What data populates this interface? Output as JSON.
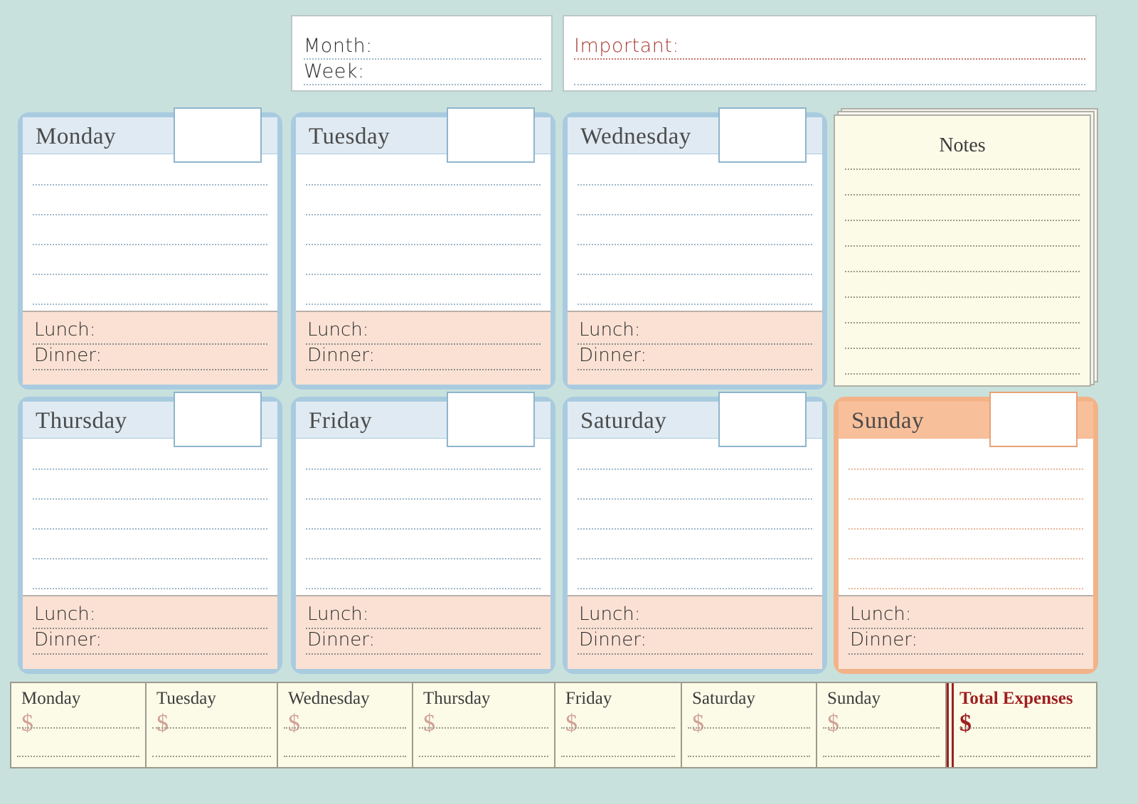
{
  "background_color": "#c9e1dd",
  "header": {
    "month_label": "Month:",
    "week_label": "Week:",
    "important_label": "Important:",
    "important_color": "#a83c32"
  },
  "meal": {
    "lunch_label": "Lunch:",
    "dinner_label": "Dinner:"
  },
  "notes": {
    "title": "Notes",
    "line_count": 9,
    "paper_color": "#fcfbe8"
  },
  "days": [
    {
      "name": "Monday",
      "accent": "#a9cbe0",
      "header_bg": "#dfeaf2",
      "line_color": "#9fb7c9",
      "date_value": ""
    },
    {
      "name": "Tuesday",
      "accent": "#a9cbe0",
      "header_bg": "#dfeaf2",
      "line_color": "#9fb7c9",
      "date_value": ""
    },
    {
      "name": "Wednesday",
      "accent": "#a9cbe0",
      "header_bg": "#dfeaf2",
      "line_color": "#9fb7c9",
      "date_value": ""
    },
    {
      "name": "Thursday",
      "accent": "#a9cbe0",
      "header_bg": "#dfeaf2",
      "line_color": "#9fb7c9",
      "date_value": ""
    },
    {
      "name": "Friday",
      "accent": "#a9cbe0",
      "header_bg": "#dfeaf2",
      "line_color": "#9fb7c9",
      "date_value": ""
    },
    {
      "name": "Saturday",
      "accent": "#a9cbe0",
      "header_bg": "#dfeaf2",
      "line_color": "#9fb7c9",
      "date_value": ""
    },
    {
      "name": "Sunday",
      "accent": "#f3b389",
      "header_bg": "#f8c09a",
      "line_color": "#e8b69a",
      "date_value": ""
    }
  ],
  "expenses": {
    "columns": [
      {
        "label": "Monday",
        "currency": "$",
        "value": ""
      },
      {
        "label": "Tuesday",
        "currency": "$",
        "value": ""
      },
      {
        "label": "Wednesday",
        "currency": "$",
        "value": ""
      },
      {
        "label": "Thursday",
        "currency": "$",
        "value": ""
      },
      {
        "label": "Friday",
        "currency": "$",
        "value": ""
      },
      {
        "label": "Saturday",
        "currency": "$",
        "value": ""
      },
      {
        "label": "Sunday",
        "currency": "$",
        "value": ""
      }
    ],
    "total": {
      "label": "Total Expenses",
      "currency": "$",
      "value": "",
      "color": "#9e1f1f"
    }
  }
}
